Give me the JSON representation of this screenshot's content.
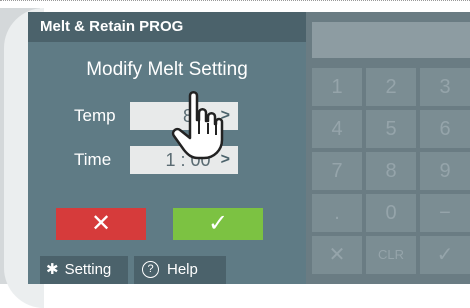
{
  "header": {
    "title": "Melt & Retain PROG"
  },
  "dialog": {
    "subtitle": "Modify Melt Setting",
    "temp": {
      "label": "Temp",
      "value": "8",
      "arrow": ">"
    },
    "time": {
      "label": "Time",
      "value": "1 : 00",
      "arrow": ">"
    },
    "cancel_symbol": "✕",
    "ok_symbol": "✓"
  },
  "bottom_bar": {
    "setting": {
      "icon": "gear-icon",
      "label": "Setting"
    },
    "help": {
      "icon": "help-icon",
      "label": "Help",
      "glyph": "?"
    }
  },
  "keypad": {
    "keys": [
      "1",
      "2",
      "3",
      "4",
      "5",
      "6",
      "7",
      "8",
      "9",
      ".",
      "0",
      "−",
      "✕",
      "CLR",
      "✓"
    ]
  },
  "colors": {
    "panel": "#5f7b85",
    "title_bar": "#4b626b",
    "cancel": "#d63b3b",
    "ok": "#7cc242",
    "keypad_bg": "#6a7c83"
  }
}
